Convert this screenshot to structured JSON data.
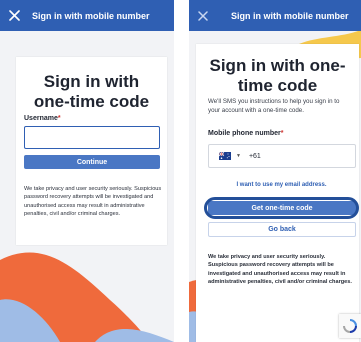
{
  "colors": {
    "header": "#2f5fb3",
    "primary_button": "#4a77c4",
    "accent_yellow": "#f5c84c",
    "accent_orange": "#ef6a3c",
    "accent_blue": "#9fbce6"
  },
  "left_screen": {
    "header_title": "Sign in with mobile number",
    "close_icon": "close-icon",
    "title": "Sign in with one-time code",
    "username_label": "Username",
    "required_mark": "*",
    "username_value": "",
    "continue_label": "Continue",
    "disclaimer": "We take privacy and user security seriously. Suspicious password recovery attempts will be investigated and unauthorised access may result in administrative penalties, civil and/or criminal charges."
  },
  "right_screen": {
    "header_title": "Sign in with mobile number",
    "close_icon": "close-icon",
    "title": "Sign in with one-time code",
    "intro": "We'll SMS you instructions to help you sign in to your account with a one-time code.",
    "phone_label": "Mobile phone number",
    "required_mark": "*",
    "country_flag": "australia-flag-icon",
    "dial_code": "+61",
    "email_link": "I want to use my email address.",
    "get_code_label": "Get one-time code",
    "go_back_label": "Go back",
    "disclaimer": "We take privacy and user security seriously. Suspicious password recovery attempts will be investigated and unauthorised access may result in administrative penalties, civil and/or criminal charges."
  }
}
